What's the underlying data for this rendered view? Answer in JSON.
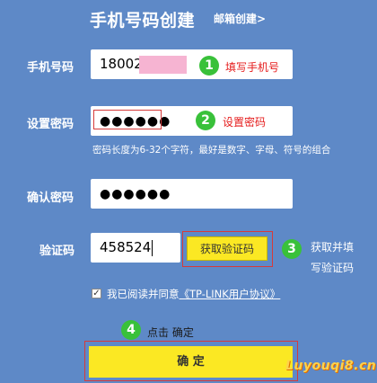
{
  "header": {
    "title": "手机号码创建",
    "email_link": "邮箱创建>"
  },
  "form": {
    "phone": {
      "label": "手机号码",
      "value": "18002"
    },
    "password": {
      "label": "设置密码",
      "value": "●●●●●●",
      "hint": "密码长度为6-32个字符，最好是数字、字母、符号的组合"
    },
    "confirm": {
      "label": "确认密码",
      "value": "●●●●●●"
    },
    "captcha": {
      "label": "验证码",
      "value": "458524",
      "button_label": "获取验证码"
    },
    "agreement": {
      "check": "✓",
      "text_prefix": "我已阅读并同意",
      "link_text": "《TP-LINK用户协议》"
    },
    "submit_label": "确 定"
  },
  "annotations": {
    "step1": {
      "number": "1",
      "text": "填写手机号"
    },
    "step2": {
      "number": "2",
      "text": "设置密码"
    },
    "step3": {
      "number": "3",
      "line1": "获取并填",
      "line2": "写验证码"
    },
    "step4": {
      "number": "4",
      "text": "点击 确定"
    }
  },
  "watermark": {
    "text": "Luyouqi8.cn"
  },
  "colors": {
    "background": "#5e89c7",
    "button": "#fbe823",
    "annotation_red": "#e51c1c",
    "step_green": "#39c13a"
  }
}
